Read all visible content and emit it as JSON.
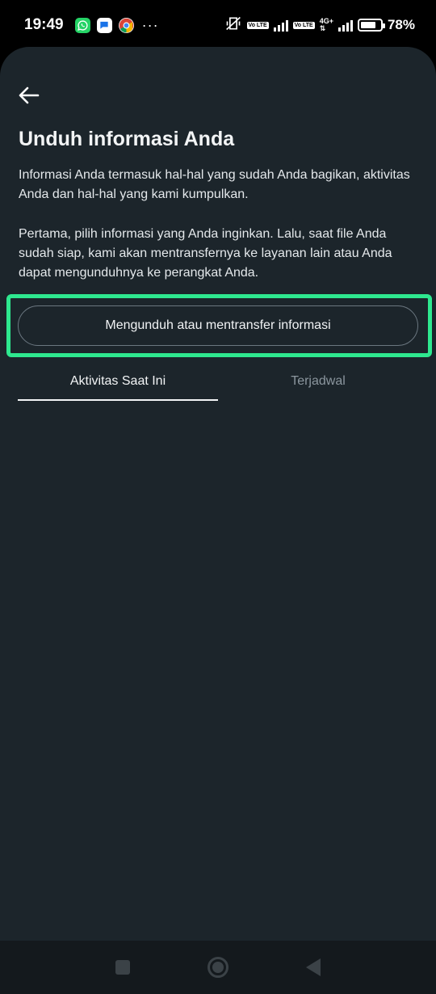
{
  "status_bar": {
    "time": "19:49",
    "battery_percent": "78%",
    "battery_level": 0.78,
    "network_label": "4G+",
    "lte_badge": "Vo LTE",
    "notification_icons": [
      "whatsapp-icon",
      "messages-icon",
      "chrome-icon"
    ],
    "more_indicator": "···"
  },
  "header": {
    "back_icon": "arrow-left-icon"
  },
  "main": {
    "title": "Unduh informasi Anda",
    "paragraph_1": "Informasi Anda termasuk hal-hal yang sudah Anda bagikan, aktivitas Anda dan hal-hal yang kami kumpulkan.",
    "paragraph_2": "Pertama, pilih informasi yang Anda inginkan. Lalu, saat file Anda sudah siap, kami akan mentransfernya ke layanan lain atau Anda dapat mengunduhnya ke perangkat Anda.",
    "primary_button_label": "Mengunduh atau mentransfer informasi",
    "tabs": [
      {
        "label": "Aktivitas Saat Ini",
        "active": true
      },
      {
        "label": "Terjadwal",
        "active": false
      }
    ]
  },
  "colors": {
    "background": "#1c252b",
    "highlight": "#2ee88f",
    "text_primary": "#f2f4f5",
    "text_muted": "#8b969e"
  }
}
